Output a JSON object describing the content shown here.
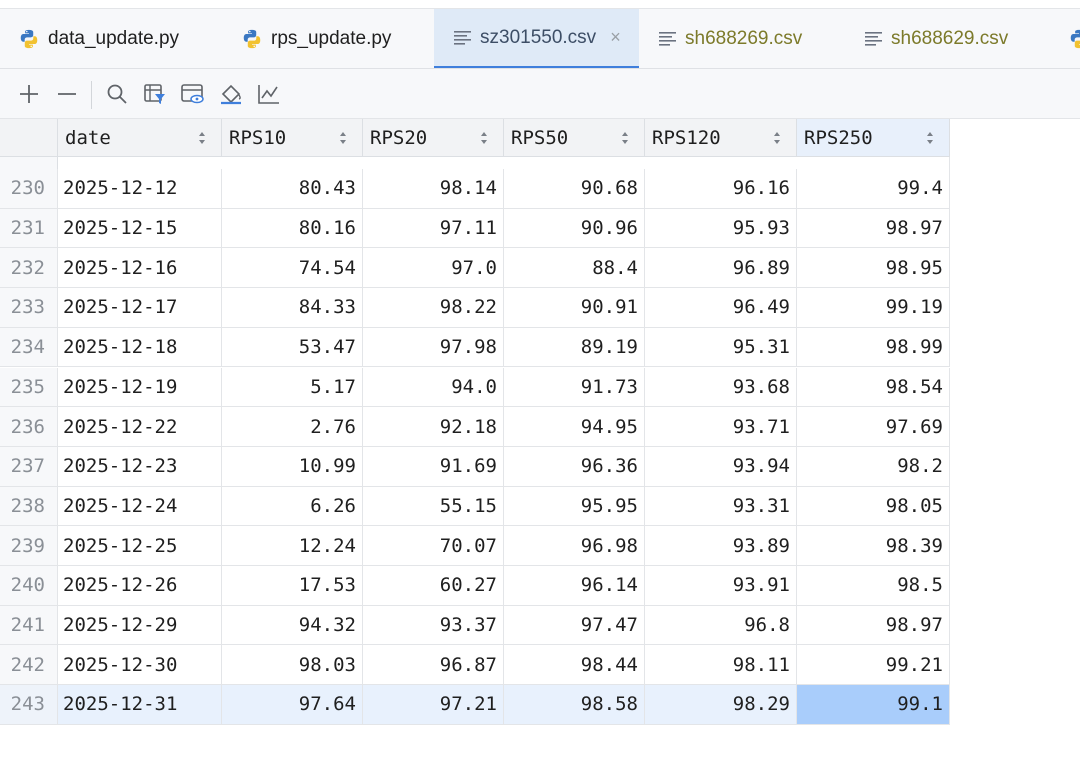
{
  "tabs": [
    {
      "label": "data_update.py",
      "type": "python",
      "active": false
    },
    {
      "label": "rps_update.py",
      "type": "python",
      "active": false
    },
    {
      "label": "sz301550.csv",
      "type": "csv",
      "active": true,
      "close": "×"
    },
    {
      "label": "sh688269.csv",
      "type": "csv",
      "active": false
    },
    {
      "label": "sh688629.csv",
      "type": "csv",
      "active": false
    }
  ],
  "toolbar": {
    "icons": [
      "add-row-icon",
      "remove-row-icon",
      "search-icon",
      "filter-icon",
      "view-icon",
      "paint-icon",
      "chart-icon"
    ]
  },
  "table": {
    "columns": [
      "date",
      "RPS10",
      "RPS20",
      "RPS50",
      "RPS120",
      "RPS250"
    ],
    "rows": [
      {
        "n": "230",
        "cells": [
          "2025-12-12",
          "80.43",
          "98.14",
          "90.68",
          "96.16",
          "99.4"
        ]
      },
      {
        "n": "231",
        "cells": [
          "2025-12-15",
          "80.16",
          "97.11",
          "90.96",
          "95.93",
          "98.97"
        ]
      },
      {
        "n": "232",
        "cells": [
          "2025-12-16",
          "74.54",
          "97.0",
          "88.4",
          "96.89",
          "98.95"
        ]
      },
      {
        "n": "233",
        "cells": [
          "2025-12-17",
          "84.33",
          "98.22",
          "90.91",
          "96.49",
          "99.19"
        ]
      },
      {
        "n": "234",
        "cells": [
          "2025-12-18",
          "53.47",
          "97.98",
          "89.19",
          "95.31",
          "98.99"
        ]
      },
      {
        "n": "235",
        "cells": [
          "2025-12-19",
          "5.17",
          "94.0",
          "91.73",
          "93.68",
          "98.54"
        ]
      },
      {
        "n": "236",
        "cells": [
          "2025-12-22",
          "2.76",
          "92.18",
          "94.95",
          "93.71",
          "97.69"
        ]
      },
      {
        "n": "237",
        "cells": [
          "2025-12-23",
          "10.99",
          "91.69",
          "96.36",
          "93.94",
          "98.2"
        ]
      },
      {
        "n": "238",
        "cells": [
          "2025-12-24",
          "6.26",
          "55.15",
          "95.95",
          "93.31",
          "98.05"
        ]
      },
      {
        "n": "239",
        "cells": [
          "2025-12-25",
          "12.24",
          "70.07",
          "96.98",
          "93.89",
          "98.39"
        ]
      },
      {
        "n": "240",
        "cells": [
          "2025-12-26",
          "17.53",
          "60.27",
          "96.14",
          "93.91",
          "98.5"
        ]
      },
      {
        "n": "241",
        "cells": [
          "2025-12-29",
          "94.32",
          "93.37",
          "97.47",
          "96.8",
          "98.97"
        ]
      },
      {
        "n": "242",
        "cells": [
          "2025-12-30",
          "98.03",
          "96.87",
          "98.44",
          "98.11",
          "99.21"
        ]
      },
      {
        "n": "243",
        "cells": [
          "2025-12-31",
          "97.64",
          "97.21",
          "98.58",
          "98.29",
          "99.1"
        ]
      }
    ],
    "selected_row": "243",
    "current_column": "RPS250"
  },
  "colors": {
    "accent": "#3f7fdc",
    "selection": "#e8f1fd",
    "current_cell": "#a9cdfb",
    "csv_tab_text": "#7c7a2a"
  }
}
